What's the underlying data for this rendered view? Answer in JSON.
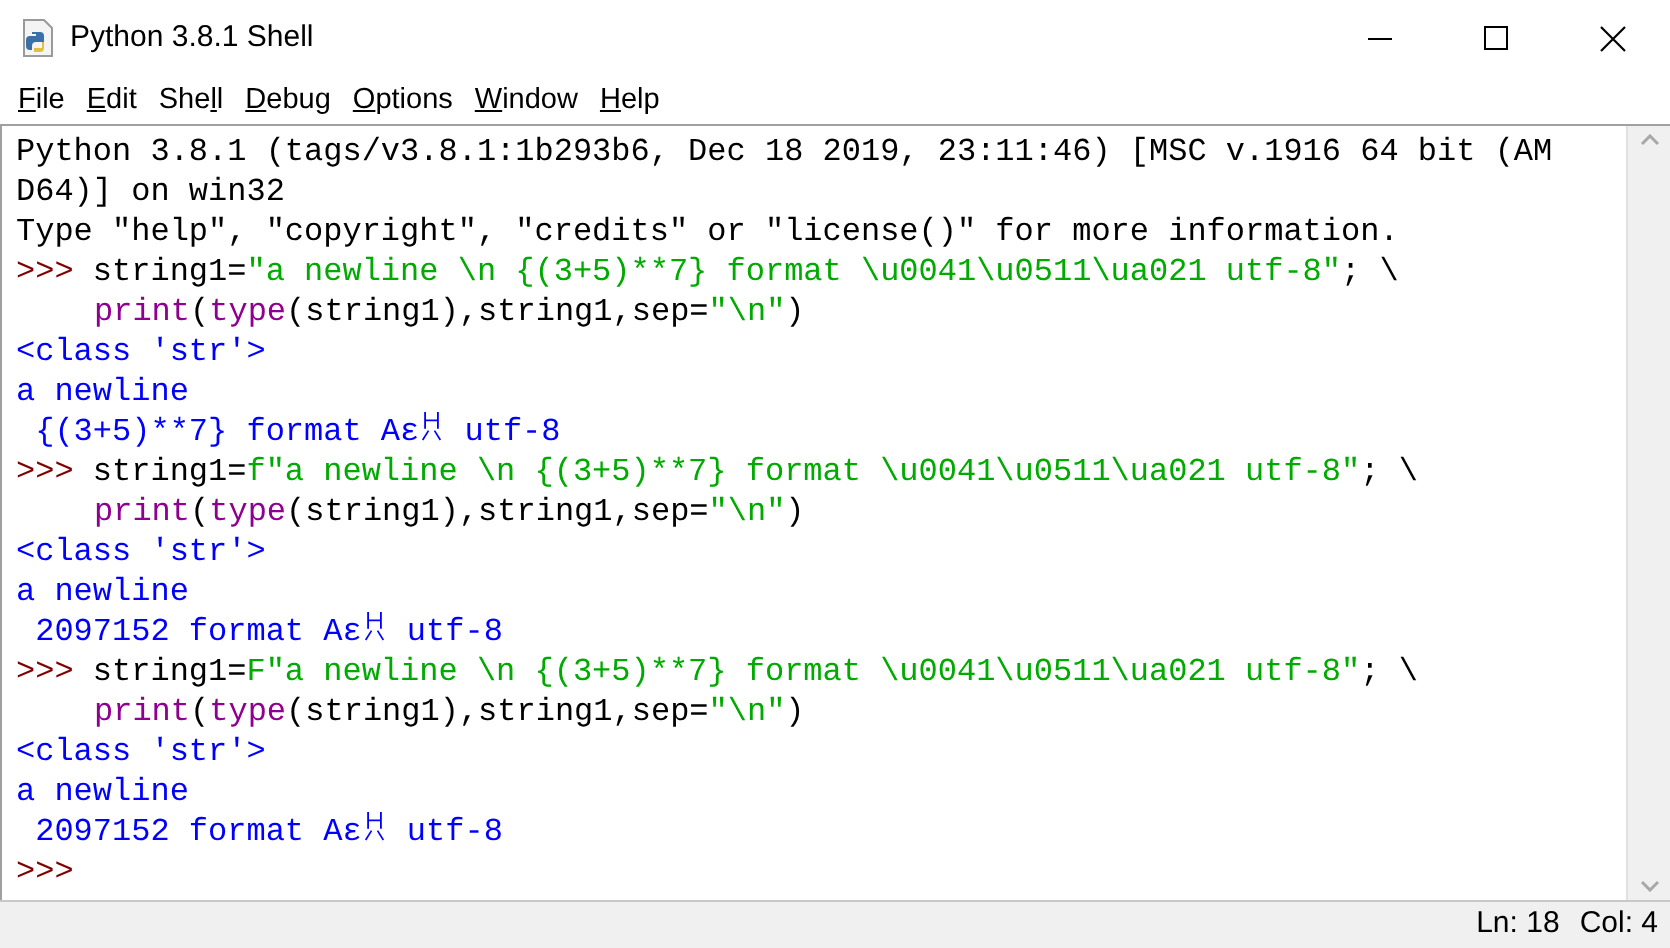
{
  "window": {
    "title": "Python 3.8.1 Shell"
  },
  "menu": [
    [
      {
        "text": "F",
        "underlined": true
      },
      {
        "text": "ile",
        "underlined": false
      }
    ],
    [
      {
        "text": "E",
        "underlined": true
      },
      {
        "text": "dit",
        "underlined": false
      }
    ],
    [
      {
        "text": "She",
        "underlined": false
      },
      {
        "text": "l",
        "underlined": true
      },
      {
        "text": "l",
        "underlined": false
      }
    ],
    [
      {
        "text": "D",
        "underlined": true
      },
      {
        "text": "ebug",
        "underlined": false
      }
    ],
    [
      {
        "text": "O",
        "underlined": true
      },
      {
        "text": "ptions",
        "underlined": false
      }
    ],
    [
      {
        "text": "W",
        "underlined": true
      },
      {
        "text": "indow",
        "underlined": false
      }
    ],
    [
      {
        "text": "H",
        "underlined": true
      },
      {
        "text": "elp",
        "underlined": false
      }
    ]
  ],
  "shell_lines": [
    {
      "segments": [
        {
          "kind": "code",
          "text": "Python 3.8.1 (tags/v3.8.1:1b293b6, Dec 18 2019, 23:11:46) [MSC v.1916 64 bit (AM"
        }
      ]
    },
    {
      "segments": [
        {
          "kind": "code",
          "text": "D64)] on win32"
        }
      ]
    },
    {
      "segments": [
        {
          "kind": "code",
          "text": "Type \"help\", \"copyright\", \"credits\" or \"license()\" for more information."
        }
      ]
    },
    {
      "segments": [
        {
          "kind": "prompt",
          "text": ">>> "
        },
        {
          "kind": "code",
          "text": "string1="
        },
        {
          "kind": "string",
          "text": "\"a newline \\n {(3+5)**7} format \\u0041\\u0511\\ua021 utf-8\""
        },
        {
          "kind": "code",
          "text": "; \\"
        }
      ]
    },
    {
      "continuation": true,
      "segments": [
        {
          "kind": "builtin",
          "text": "print"
        },
        {
          "kind": "code",
          "text": "("
        },
        {
          "kind": "builtin",
          "text": "type"
        },
        {
          "kind": "code",
          "text": "(string1),string1,sep="
        },
        {
          "kind": "string",
          "text": "\"\\n\""
        },
        {
          "kind": "code",
          "text": ")"
        }
      ]
    },
    {
      "continuation": false,
      "segments": [
        {
          "kind": "stdout",
          "text": "<class 'str'>"
        }
      ]
    },
    {
      "continuation": false,
      "segments": [
        {
          "kind": "stdout",
          "text": "a newline"
        }
      ]
    },
    {
      "continuation": false,
      "segments": [
        {
          "kind": "stdout",
          "text": " {(3+5)**7} format Aԑꀡ utf-8"
        }
      ]
    },
    {
      "segments": [
        {
          "kind": "prompt",
          "text": ">>> "
        },
        {
          "kind": "code",
          "text": "string1="
        },
        {
          "kind": "string",
          "text": "f\"a newline \\n {(3+5)**7} format \\u0041\\u0511\\ua021 utf-8\""
        },
        {
          "kind": "code",
          "text": "; \\"
        }
      ]
    },
    {
      "continuation": true,
      "segments": [
        {
          "kind": "builtin",
          "text": "print"
        },
        {
          "kind": "code",
          "text": "("
        },
        {
          "kind": "builtin",
          "text": "type"
        },
        {
          "kind": "code",
          "text": "(string1),string1,sep="
        },
        {
          "kind": "string",
          "text": "\"\\n\""
        },
        {
          "kind": "code",
          "text": ")"
        }
      ]
    },
    {
      "continuation": false,
      "segments": [
        {
          "kind": "stdout",
          "text": "<class 'str'>"
        }
      ]
    },
    {
      "continuation": false,
      "segments": [
        {
          "kind": "stdout",
          "text": "a newline"
        }
      ]
    },
    {
      "continuation": false,
      "segments": [
        {
          "kind": "stdout",
          "text": " 2097152 format Aԑꀡ utf-8"
        }
      ]
    },
    {
      "segments": [
        {
          "kind": "prompt",
          "text": ">>> "
        },
        {
          "kind": "code",
          "text": "string1="
        },
        {
          "kind": "string",
          "text": "F\"a newline \\n {(3+5)**7} format \\u0041\\u0511\\ua021 utf-8\""
        },
        {
          "kind": "code",
          "text": "; \\"
        }
      ]
    },
    {
      "continuation": true,
      "segments": [
        {
          "kind": "builtin",
          "text": "print"
        },
        {
          "kind": "code",
          "text": "("
        },
        {
          "kind": "builtin",
          "text": "type"
        },
        {
          "kind": "code",
          "text": "(string1),string1,sep="
        },
        {
          "kind": "string",
          "text": "\"\\n\""
        },
        {
          "kind": "code",
          "text": ")"
        }
      ]
    },
    {
      "continuation": false,
      "segments": [
        {
          "kind": "stdout",
          "text": "<class 'str'>"
        }
      ]
    },
    {
      "continuation": false,
      "segments": [
        {
          "kind": "stdout",
          "text": "a newline"
        }
      ]
    },
    {
      "continuation": false,
      "segments": [
        {
          "kind": "stdout",
          "text": " 2097152 format Aԑꀡ utf-8"
        }
      ]
    },
    {
      "segments": [
        {
          "kind": "prompt",
          "text": ">>>"
        }
      ]
    }
  ],
  "status_bar": {
    "line": "Ln: 18",
    "column": "Col: 4"
  }
}
